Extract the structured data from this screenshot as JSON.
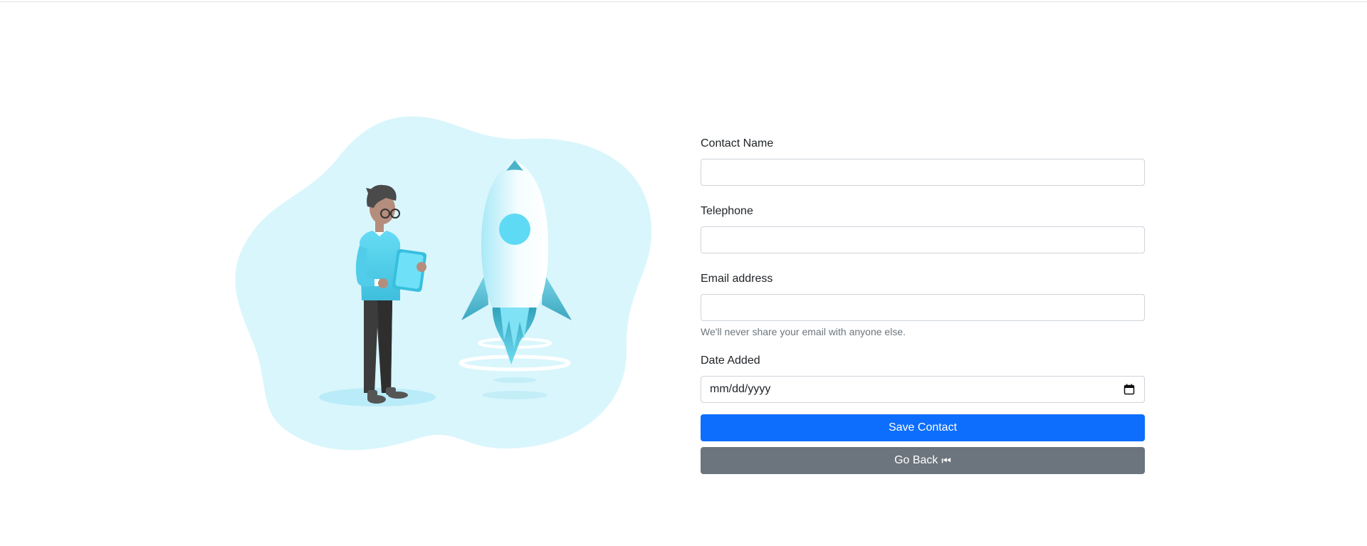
{
  "form": {
    "contact_name": {
      "label": "Contact Name",
      "value": "",
      "placeholder": ""
    },
    "telephone": {
      "label": "Telephone",
      "value": "",
      "placeholder": ""
    },
    "email": {
      "label": "Email address",
      "value": "",
      "placeholder": "",
      "help": "We'll never share your email with anyone else."
    },
    "date_added": {
      "label": "Date Added",
      "placeholder": "mm/dd/yyyy"
    },
    "save_button": "Save Contact",
    "back_button": {
      "label": "Go Back",
      "icon": "⏮"
    }
  },
  "icons": {
    "calendar": "calendar-icon"
  },
  "colors": {
    "primary": "#0d6efd",
    "secondary": "#6c757d",
    "illustration_bg": "#d9f6fc",
    "accent": "#5ed6f0"
  }
}
